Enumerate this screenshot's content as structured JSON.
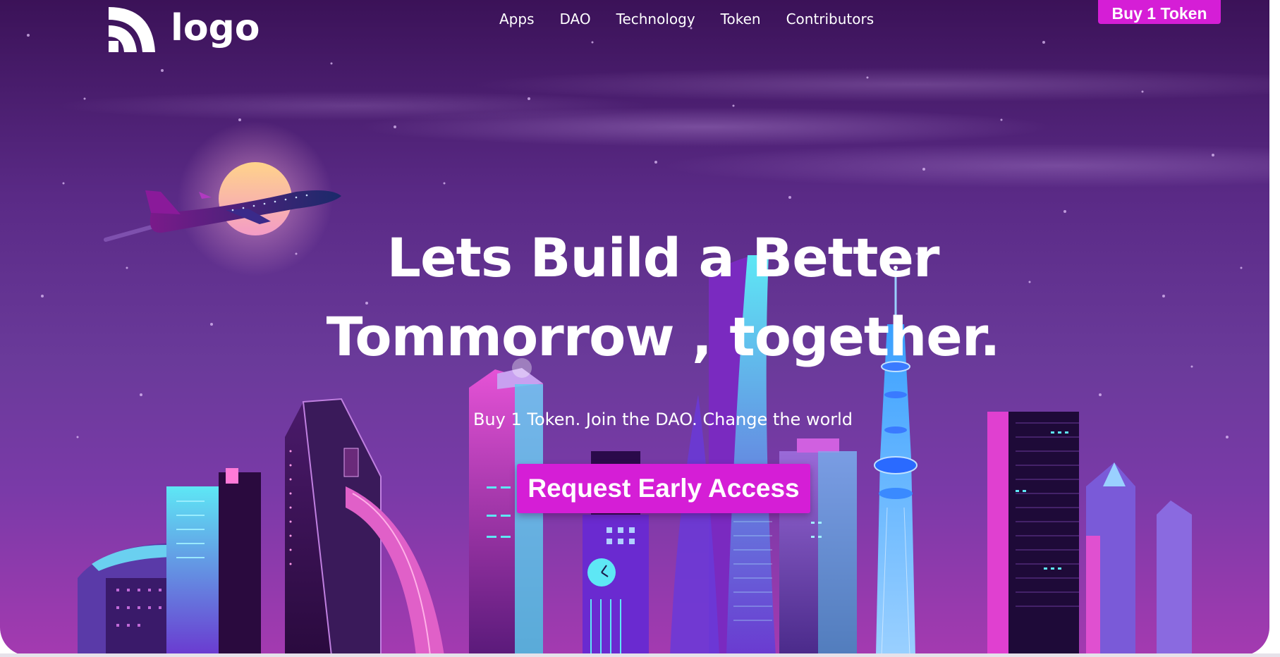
{
  "logo": {
    "text": "logo",
    "icon": "wifi-arcs-logo-icon"
  },
  "nav": {
    "items": [
      {
        "label": "Apps"
      },
      {
        "label": "DAO"
      },
      {
        "label": "Technology"
      },
      {
        "label": "Token"
      },
      {
        "label": "Contributors"
      }
    ]
  },
  "header": {
    "buy_button": "Buy 1 Token"
  },
  "hero": {
    "headline_line1": "Lets Build a Better",
    "headline_line2": "Tommorrow , together.",
    "subtitle": "Buy 1 Token. Join the DAO. Change the world",
    "cta": "Request Early Access"
  },
  "colors": {
    "accent": "#d51ed6",
    "sky_top": "#3b1258",
    "sky_bottom": "#a43ab0",
    "moon": "#f6c27a",
    "text": "#ffffff"
  }
}
